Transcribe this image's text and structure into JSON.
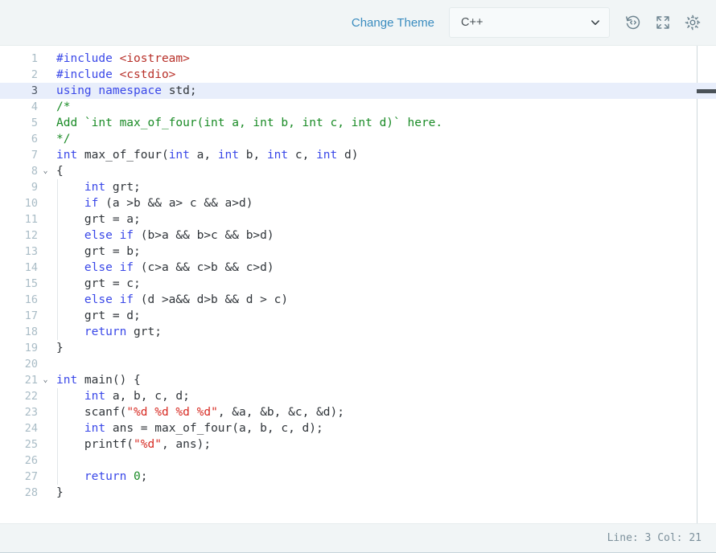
{
  "toolbar": {
    "change_theme_label": "Change Theme",
    "language_select": {
      "value": "C++",
      "chevron_icon": "chevron-down-icon"
    },
    "icons": [
      {
        "name": "history-restore-icon",
        "title": "Restore code"
      },
      {
        "name": "fullscreen-expand-icon",
        "title": "Full screen"
      },
      {
        "name": "gear-settings-icon",
        "title": "Settings"
      }
    ]
  },
  "editor": {
    "active_line": 3,
    "accent_link_color": "#3a8cbf",
    "active_line_bg": "#e8eefb",
    "colors": {
      "keyword": "#3a48e8",
      "string": "#d72b23",
      "comment": "#1a8b26",
      "number": "#1a8b26",
      "include_path": "#b8312a",
      "plain": "#30353a",
      "line_number": "#a9bcc6"
    },
    "lines": [
      {
        "n": "1",
        "fold": "",
        "indent": 0,
        "tokens": [
          {
            "t": "#include ",
            "c": "t-pre"
          },
          {
            "t": "<iostream>",
            "c": "t-inc"
          }
        ]
      },
      {
        "n": "2",
        "fold": "",
        "indent": 0,
        "tokens": [
          {
            "t": "#include ",
            "c": "t-pre"
          },
          {
            "t": "<cstdio>",
            "c": "t-inc"
          }
        ]
      },
      {
        "n": "3",
        "fold": "",
        "indent": 0,
        "active": true,
        "tokens": [
          {
            "t": "using namespace ",
            "c": "t-key"
          },
          {
            "t": "std;",
            "c": "t-pln"
          }
        ]
      },
      {
        "n": "4",
        "fold": "",
        "indent": 0,
        "tokens": [
          {
            "t": "/*",
            "c": "t-com"
          }
        ]
      },
      {
        "n": "5",
        "fold": "",
        "indent": 0,
        "tokens": [
          {
            "t": "Add `int max_of_four(int a, int b, int c, int d)` here.",
            "c": "t-com"
          }
        ]
      },
      {
        "n": "6",
        "fold": "",
        "indent": 0,
        "tokens": [
          {
            "t": "*/",
            "c": "t-com"
          }
        ]
      },
      {
        "n": "7",
        "fold": "",
        "indent": 0,
        "tokens": [
          {
            "t": "int",
            "c": "t-key"
          },
          {
            "t": " max_of_four(",
            "c": "t-pln"
          },
          {
            "t": "int",
            "c": "t-key"
          },
          {
            "t": " a, ",
            "c": "t-pln"
          },
          {
            "t": "int",
            "c": "t-key"
          },
          {
            "t": " b, ",
            "c": "t-pln"
          },
          {
            "t": "int",
            "c": "t-key"
          },
          {
            "t": " c, ",
            "c": "t-pln"
          },
          {
            "t": "int",
            "c": "t-key"
          },
          {
            "t": " d)",
            "c": "t-pln"
          }
        ]
      },
      {
        "n": "8",
        "fold": "v",
        "indent": 0,
        "tokens": [
          {
            "t": "{",
            "c": "t-pln"
          }
        ]
      },
      {
        "n": "9",
        "fold": "",
        "indent": 1,
        "tokens": [
          {
            "t": "    ",
            "c": "t-pln"
          },
          {
            "t": "int",
            "c": "t-key"
          },
          {
            "t": " grt;",
            "c": "t-pln"
          }
        ]
      },
      {
        "n": "10",
        "fold": "",
        "indent": 1,
        "tokens": [
          {
            "t": "    ",
            "c": "t-pln"
          },
          {
            "t": "if",
            "c": "t-key"
          },
          {
            "t": " (a >b && a> c && a>d)",
            "c": "t-pln"
          }
        ]
      },
      {
        "n": "11",
        "fold": "",
        "indent": 1,
        "tokens": [
          {
            "t": "    grt = a;",
            "c": "t-pln"
          }
        ]
      },
      {
        "n": "12",
        "fold": "",
        "indent": 1,
        "tokens": [
          {
            "t": "    ",
            "c": "t-pln"
          },
          {
            "t": "else if",
            "c": "t-key"
          },
          {
            "t": " (b>a && b>c && b>d)",
            "c": "t-pln"
          }
        ]
      },
      {
        "n": "13",
        "fold": "",
        "indent": 1,
        "tokens": [
          {
            "t": "    grt = b;",
            "c": "t-pln"
          }
        ]
      },
      {
        "n": "14",
        "fold": "",
        "indent": 1,
        "tokens": [
          {
            "t": "    ",
            "c": "t-pln"
          },
          {
            "t": "else if",
            "c": "t-key"
          },
          {
            "t": " (c>a && c>b && c>d)",
            "c": "t-pln"
          }
        ]
      },
      {
        "n": "15",
        "fold": "",
        "indent": 1,
        "tokens": [
          {
            "t": "    grt = c;",
            "c": "t-pln"
          }
        ]
      },
      {
        "n": "16",
        "fold": "",
        "indent": 1,
        "tokens": [
          {
            "t": "    ",
            "c": "t-pln"
          },
          {
            "t": "else if",
            "c": "t-key"
          },
          {
            "t": " (d >a&& d>b && d > c)",
            "c": "t-pln"
          }
        ]
      },
      {
        "n": "17",
        "fold": "",
        "indent": 1,
        "tokens": [
          {
            "t": "    grt = d;",
            "c": "t-pln"
          }
        ]
      },
      {
        "n": "18",
        "fold": "",
        "indent": 1,
        "tokens": [
          {
            "t": "    ",
            "c": "t-pln"
          },
          {
            "t": "return",
            "c": "t-key"
          },
          {
            "t": " grt;",
            "c": "t-pln"
          }
        ]
      },
      {
        "n": "19",
        "fold": "",
        "indent": 0,
        "tokens": [
          {
            "t": "}",
            "c": "t-pln"
          }
        ]
      },
      {
        "n": "20",
        "fold": "",
        "indent": 0,
        "tokens": [
          {
            "t": "",
            "c": "t-pln"
          }
        ]
      },
      {
        "n": "21",
        "fold": "v",
        "indent": 0,
        "tokens": [
          {
            "t": "int",
            "c": "t-key"
          },
          {
            "t": " main() {",
            "c": "t-pln"
          }
        ]
      },
      {
        "n": "22",
        "fold": "",
        "indent": 1,
        "tokens": [
          {
            "t": "    ",
            "c": "t-pln"
          },
          {
            "t": "int",
            "c": "t-key"
          },
          {
            "t": " a, b, c, d;",
            "c": "t-pln"
          }
        ]
      },
      {
        "n": "23",
        "fold": "",
        "indent": 1,
        "tokens": [
          {
            "t": "    scanf(",
            "c": "t-pln"
          },
          {
            "t": "\"%d %d %d %d\"",
            "c": "t-str"
          },
          {
            "t": ", &a, &b, &c, &d);",
            "c": "t-pln"
          }
        ]
      },
      {
        "n": "24",
        "fold": "",
        "indent": 1,
        "tokens": [
          {
            "t": "    ",
            "c": "t-pln"
          },
          {
            "t": "int",
            "c": "t-key"
          },
          {
            "t": " ans = max_of_four(a, b, c, d);",
            "c": "t-pln"
          }
        ]
      },
      {
        "n": "25",
        "fold": "",
        "indent": 1,
        "tokens": [
          {
            "t": "    printf(",
            "c": "t-pln"
          },
          {
            "t": "\"%d\"",
            "c": "t-str"
          },
          {
            "t": ", ans);",
            "c": "t-pln"
          }
        ]
      },
      {
        "n": "26",
        "fold": "",
        "indent": 1,
        "tokens": [
          {
            "t": "",
            "c": "t-pln"
          }
        ]
      },
      {
        "n": "27",
        "fold": "",
        "indent": 1,
        "tokens": [
          {
            "t": "    ",
            "c": "t-pln"
          },
          {
            "t": "return",
            "c": "t-key"
          },
          {
            "t": " ",
            "c": "t-pln"
          },
          {
            "t": "0",
            "c": "t-num"
          },
          {
            "t": ";",
            "c": "t-pln"
          }
        ]
      },
      {
        "n": "28",
        "fold": "",
        "indent": 0,
        "tokens": [
          {
            "t": "}",
            "c": "t-pln"
          }
        ]
      }
    ]
  },
  "status_bar": {
    "position_label": "Line: 3 Col: 21"
  }
}
